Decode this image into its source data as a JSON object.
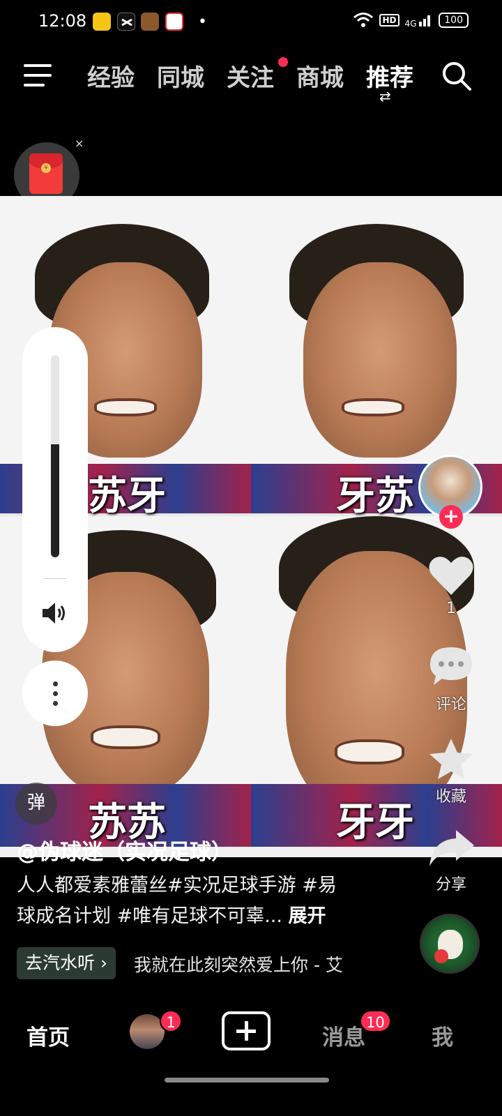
{
  "status_bar": {
    "time": "12:08",
    "hd_label": "HD",
    "signal_label": "4G",
    "battery_level": 100,
    "battery_text": "100",
    "app_icons": [
      "game-icon",
      "capcut-icon",
      "game2-icon",
      "shop-icon"
    ],
    "dot": "•"
  },
  "top_nav": {
    "tabs": [
      {
        "label": "经验",
        "active": false
      },
      {
        "label": "同城",
        "active": false
      },
      {
        "label": "关注",
        "active": false,
        "has_dot": true
      },
      {
        "label": "商城",
        "active": false
      },
      {
        "label": "推荐",
        "active": true
      }
    ],
    "switch_glyph": "⇄"
  },
  "red_packet": {
    "close_glyph": "×",
    "coin_glyph": "¥"
  },
  "video": {
    "captions": [
      "苏牙",
      "牙苏",
      "苏苏",
      "牙牙"
    ]
  },
  "volume": {
    "level_fraction": 0.56
  },
  "danmu_label": "弹",
  "right_rail": {
    "like_count": "1",
    "comment_label": "评论",
    "favorite_label": "收藏",
    "share_label": "分享",
    "follow_glyph": "+"
  },
  "caption": {
    "author": "@伪球迷（实况足球）",
    "description_line1": "人人都爱素雅蕾丝#实况足球手游 #易",
    "description_line2": "球成名计划 #唯有足球不可辜...",
    "expand_label": "展开",
    "music_chip": "去汽水听 ›",
    "music_title": "我就在此刻突然爱上你 - 艾"
  },
  "bottom_nav": {
    "home": "首页",
    "friends_badge": "1",
    "messages": "消息",
    "messages_badge": "10",
    "me": "我"
  },
  "colors": {
    "accent": "#fe2c55",
    "background": "#000000"
  }
}
